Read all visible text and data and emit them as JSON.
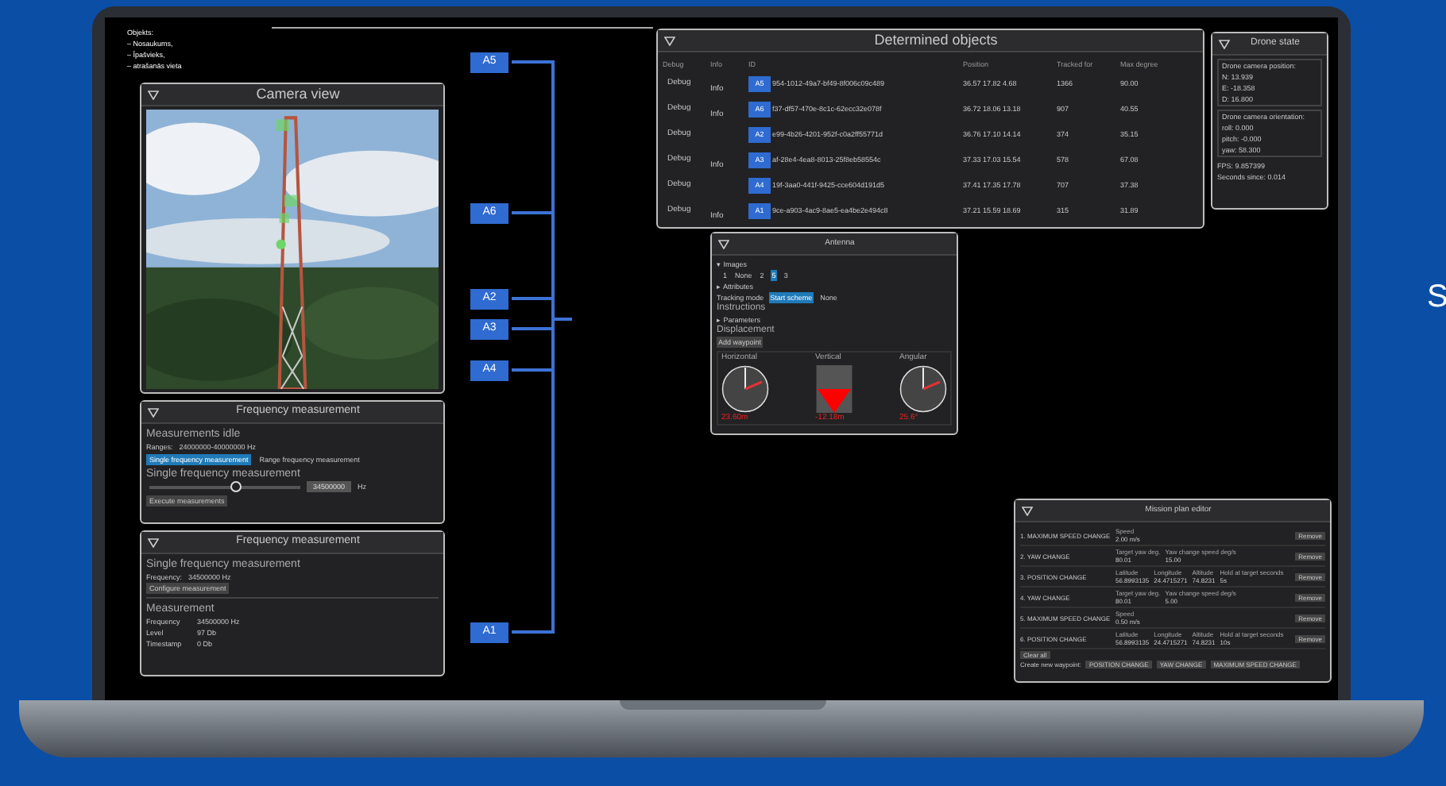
{
  "objects_note": [
    "Objekts:",
    "– Nosaukums,",
    "– Īpašvieks,",
    "– atrašanās vieta"
  ],
  "camera_view": {
    "title": "Camera view"
  },
  "frequency_panel": {
    "title": "Frequency measurement",
    "status": "Measurements idle",
    "ranges_label": "Ranges:",
    "ranges": "24000000-40000000 Hz",
    "tabs": [
      {
        "label": "Single frequency measurement",
        "selected": true
      },
      {
        "label": "Range frequency measurement",
        "selected": false
      }
    ],
    "section": "Single frequency measurement",
    "slider": {
      "level": 0.57
    },
    "value": "34500000",
    "unit": "Hz",
    "button": "Execute measurements"
  },
  "frequency_result": {
    "title": "Frequency measurement",
    "section": "Single frequency measurement",
    "frequency_label": "Frequency:",
    "frequency": "34500000 Hz",
    "button": "Configure measurement",
    "measurement_title": "Measurement",
    "fields": [
      {
        "label": "Frequency",
        "value": "34500000 Hz"
      },
      {
        "label": "Level",
        "value": "97 Db"
      },
      {
        "label": "Timestamp",
        "value": "0 Db"
      }
    ]
  },
  "labels": [
    "A5",
    "A6",
    "A2",
    "A3",
    "A4",
    "A1"
  ],
  "determined_objects": {
    "title": "Determined objects",
    "columns": [
      "Debug",
      "Info",
      "ID",
      "Position",
      "Tracked for",
      "Max degree"
    ],
    "rows": [
      {
        "debug": "Debug",
        "info": "Info",
        "tag": "A5",
        "id": "954-1012-49a7-bf49-8f006c09c489",
        "position": "36.57 17.82 4.68",
        "tracked_for": "1366",
        "max_degree": "90.00"
      },
      {
        "debug": "Debug",
        "info": "Info",
        "tag": "A6",
        "id": "f37-df57-470e-8c1c-62ecc32e078f",
        "position": "36.72 18.06 13.18",
        "tracked_for": "907",
        "max_degree": "40.55"
      },
      {
        "debug": "Debug",
        "tag": "A2",
        "id": "e99-4b26-4201-952f-c0a2ff55771d",
        "position": "36.76 17.10 14.14",
        "tracked_for": "374",
        "max_degree": "35.15"
      },
      {
        "debug": "Debug",
        "info": "Info",
        "tag": "A3",
        "id": "af-28e4-4ea8-8013-25f8eb58554c",
        "position": "37.33 17.03 15.54",
        "tracked_for": "578",
        "max_degree": "67.08"
      },
      {
        "debug": "Debug",
        "tag": "A4",
        "id": "19f-3aa0-441f-9425-cce604d191d5",
        "position": "37.41 17.35 17.78",
        "tracked_for": "707",
        "max_degree": "37.38"
      },
      {
        "debug": "Debug",
        "info": "Info",
        "tag": "A1",
        "id": "9ce-a903-4ac9-8ae5-ea4be2e494c8",
        "position": "37.21 15.59 18.69",
        "tracked_for": "315",
        "max_degree": "31.89"
      }
    ]
  },
  "drone_state": {
    "title": "Drone state",
    "groups": [
      {
        "heading": "Drone camera position:",
        "lines": [
          "N: 13.939",
          "E: -18.358",
          "D: 16.800"
        ]
      },
      {
        "heading": "Drone camera orientation:",
        "lines": [
          "roll: 0.000",
          "pitch: -0.000",
          "yaw: 58.300"
        ]
      }
    ],
    "lines": [
      "FPS: 9.857399",
      "Seconds since: 0.014"
    ]
  },
  "antenna": {
    "title": "Antenna",
    "images_label": "▾ Images",
    "image_options": [
      {
        "label": "1",
        "selected": false
      },
      {
        "label": "None",
        "selected": false
      },
      {
        "label": "2",
        "selected": false
      },
      {
        "label": "5",
        "selected": true
      },
      {
        "label": "3",
        "selected": false
      }
    ],
    "attributes_label": "▸ Attributes",
    "tracking_label": "Tracking mode",
    "tracking_options": [
      {
        "label": "Start scheme",
        "selected": true
      },
      {
        "label": "None",
        "selected": false
      }
    ],
    "instructions": "Instructions",
    "parameters_label": "▸ Parameters",
    "displacement": "Displacement",
    "button": "Add waypoint",
    "gauges": [
      {
        "kind": "dial",
        "label": "Horizontal",
        "reading": "23.60m"
      },
      {
        "kind": "triangle",
        "label": "Vertical",
        "reading": "-12.18m"
      },
      {
        "kind": "dial",
        "label": "Angular",
        "reading": "25.6°"
      }
    ]
  },
  "mission_plan_editor": {
    "title": "Mission plan editor",
    "steps": [
      {
        "label": "1. MAXIMUM SPEED CHANGE",
        "params": [
          "Speed"
        ],
        "values": [
          "2.00 m/s"
        ],
        "remove": "Remove"
      },
      {
        "label": "2. YAW CHANGE",
        "params": [
          "Target yaw deg.",
          "Yaw change speed deg/s"
        ],
        "values": [
          "80.01",
          "15.00"
        ],
        "remove": "Remove"
      },
      {
        "label": "3. POSITION CHANGE",
        "params": [
          "Latitude",
          "Longitude",
          "Altitude",
          "Hold at target seconds"
        ],
        "values": [
          "56.8993135",
          "24.4715271",
          "74.8231",
          "5s"
        ],
        "remove": "Remove"
      },
      {
        "label": "4. YAW CHANGE",
        "params": [
          "Target yaw deg.",
          "Yaw change speed deg/s"
        ],
        "values": [
          "80.01",
          "5.00"
        ],
        "remove": "Remove"
      },
      {
        "label": "5. MAXIMUM SPEED CHANGE",
        "params": [
          "Speed"
        ],
        "values": [
          "0.50 m/s"
        ],
        "remove": "Remove"
      },
      {
        "label": "6. POSITION CHANGE",
        "params": [
          "Latitude",
          "Longitude",
          "Altitude",
          "Hold at target seconds"
        ],
        "values": [
          "56.8993135",
          "24.4715271",
          "74.8231",
          "10s"
        ],
        "remove": "Remove"
      }
    ],
    "clear": "Clear all",
    "create_label": "Create new waypoint:",
    "create_buttons": [
      "POSITION CHANGE",
      "YAW CHANGE",
      "MAXIMUM SPEED CHANGE"
    ]
  },
  "side_text": "S"
}
